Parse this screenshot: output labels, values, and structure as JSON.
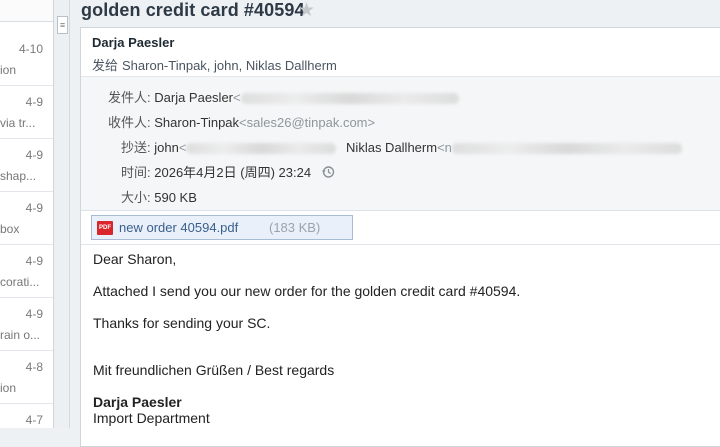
{
  "mail_list": {
    "menu_icon": "list-menu-icon",
    "items": [
      {
        "date": "4-10",
        "snippet": "ion"
      },
      {
        "date": "4-9",
        "snippet": "via tr..."
      },
      {
        "date": "4-9",
        "snippet": "shap..."
      },
      {
        "date": "4-9",
        "snippet": "box"
      },
      {
        "date": "4-9",
        "snippet": "corati..."
      },
      {
        "date": "4-9",
        "snippet": "rain o..."
      },
      {
        "date": "4-8",
        "snippet": "ion"
      },
      {
        "date": "4-7",
        "snippet": ""
      }
    ]
  },
  "message": {
    "subject": "golden credit card #40594",
    "star_icon": "star-icon",
    "sender_name": "Darja Paesler",
    "sent_to_prefix": "发给",
    "sent_to": "Sharon-Tinpak, john, Niklas Dallherm",
    "meta": {
      "from_label": "发件人:",
      "from_name": "Darja Paesler",
      "from_addr_prefix": "<",
      "to_label": "收件人:",
      "to_name": "Sharon-Tinpak",
      "to_addr": "<sales26@tinpak.com>",
      "cc_label": "抄送:",
      "cc_first": "john",
      "cc_first_addr_prefix": "<",
      "cc_second": "Niklas Dallherm",
      "cc_second_addr_prefix": "<n",
      "time_label": "时间:",
      "time_value": "2026年4月2日 (周四) 23:24",
      "history_icon": "history-icon",
      "size_label": "大小:",
      "size_value": "590 KB"
    },
    "attachment": {
      "icon": "pdf-icon",
      "icon_text": "PDF",
      "name": "new order 40594.pdf",
      "size": "(183 KB)"
    },
    "body": {
      "greeting": "Dear Sharon,",
      "line1": "Attached I send you our new order for the golden credit card #40594.",
      "line2": "Thanks for sending your SC.",
      "closing": "Mit freundlichen Grüßen / Best regards",
      "sig_name": "Darja Paesler",
      "sig_dept": "Import Department"
    }
  }
}
